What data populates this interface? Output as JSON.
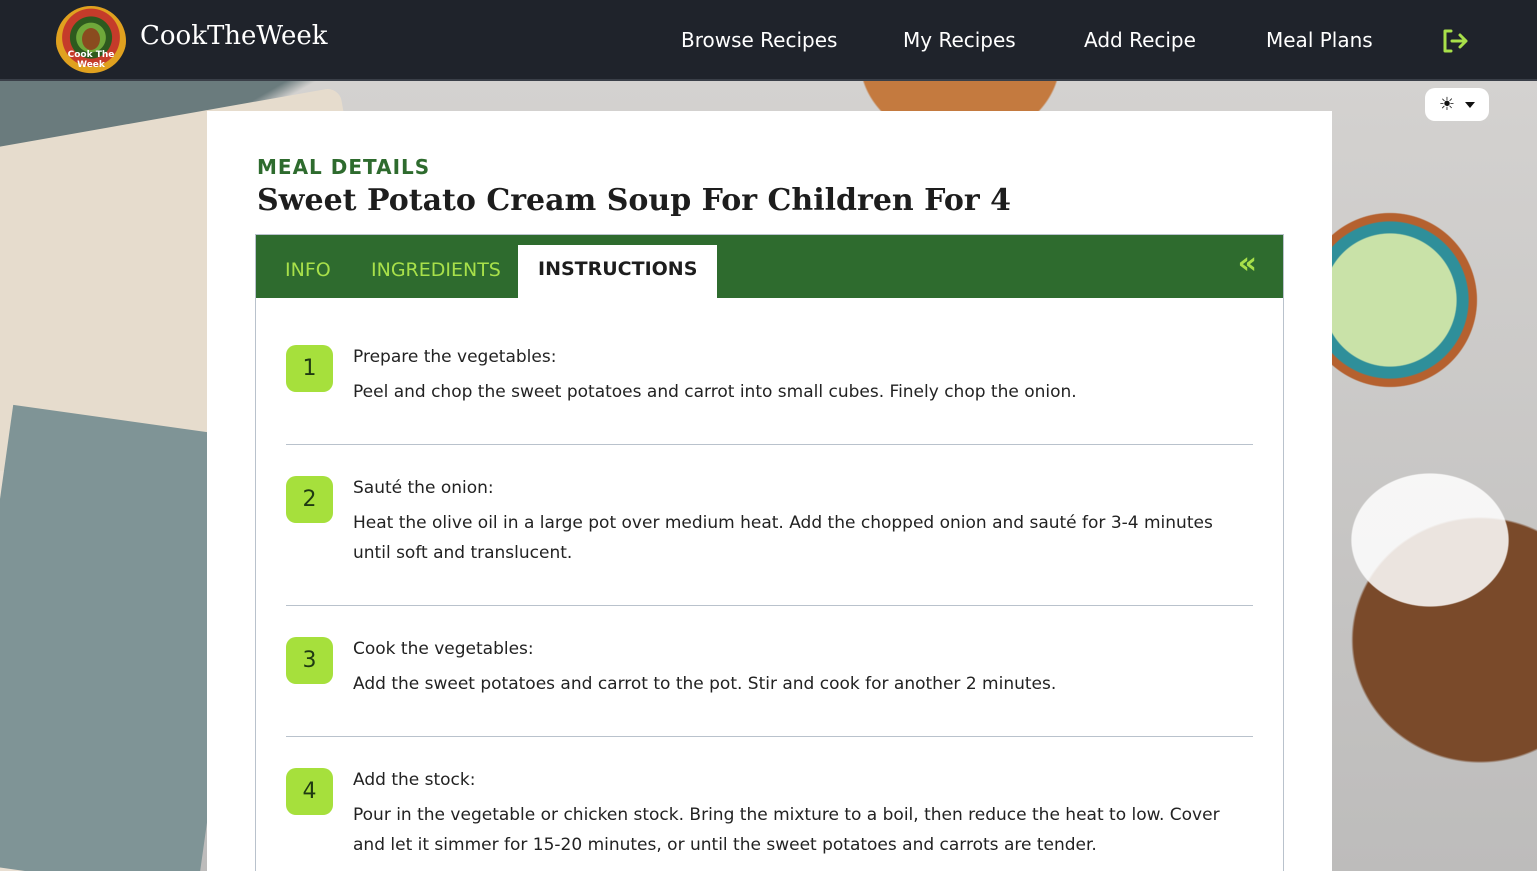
{
  "app": {
    "brand_name": "CookTheWeek",
    "logo_text": "Cook The Week"
  },
  "nav": {
    "items": [
      {
        "label": "Browse Recipes"
      },
      {
        "label": "My Recipes"
      },
      {
        "label": "Add Recipe"
      },
      {
        "label": "Meal Plans"
      }
    ],
    "logout_icon": "logout-icon"
  },
  "theme_toggle": {
    "icon": "sun-icon",
    "dropdown": "caret-down-icon"
  },
  "meal": {
    "eyebrow": "MEAL DETAILS",
    "title": "Sweet Potato Cream Soup For Children For 4"
  },
  "tabs": [
    {
      "label": "INFO",
      "active": false
    },
    {
      "label": "INGREDIENTS",
      "active": false
    },
    {
      "label": "INSTRUCTIONS",
      "active": true
    }
  ],
  "collapse_icon": "double-chevron-left-icon",
  "colors": {
    "header_bg": "#1f232b",
    "tab_bar": "#2e6b2e",
    "accent_green": "#a8e04a",
    "step_badge": "#a6e03c"
  },
  "instructions": [
    {
      "number": "1",
      "heading": "Prepare the vegetables:",
      "body": "Peel and chop the sweet potatoes and carrot into small cubes. Finely chop the onion."
    },
    {
      "number": "2",
      "heading": "Sauté the onion:",
      "body": "Heat the olive oil in a large pot over medium heat. Add the chopped onion and sauté for 3-4 minutes until soft and translucent."
    },
    {
      "number": "3",
      "heading": "Cook the vegetables:",
      "body": "Add the sweet potatoes and carrot to the pot. Stir and cook for another 2 minutes."
    },
    {
      "number": "4",
      "heading": "Add the stock:",
      "body": "Pour in the vegetable or chicken stock. Bring the mixture to a boil, then reduce the heat to low. Cover and let it simmer for 15-20 minutes, or until the sweet potatoes and carrots are tender."
    }
  ]
}
